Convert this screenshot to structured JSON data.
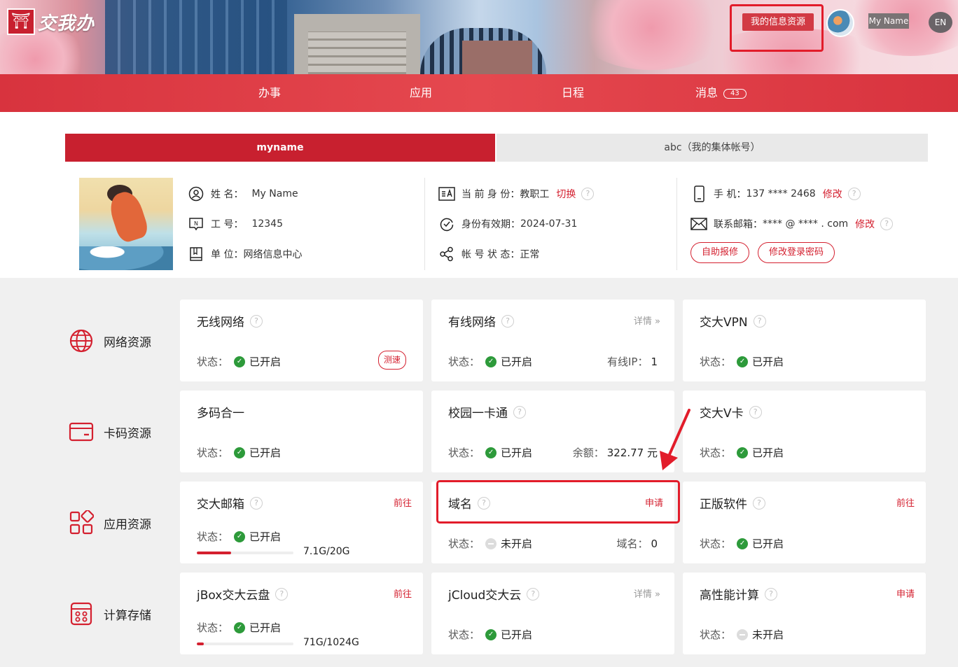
{
  "header": {
    "logo_text": "交我办",
    "info_link": "我的信息资源",
    "user_name": "My Name",
    "lang": "EN"
  },
  "nav": {
    "items": [
      {
        "label": "办事"
      },
      {
        "label": "应用"
      },
      {
        "label": "日程"
      },
      {
        "label": "消息"
      }
    ],
    "msg_count": "43"
  },
  "accounts": {
    "active": "myname",
    "inactive": "abc（我的集体帐号）"
  },
  "profile": {
    "name_label": "姓    名：",
    "name": "My Name",
    "id_label": "工    号：",
    "id": "12345",
    "unit_label": "单    位：",
    "unit": "网络信息中心",
    "identity_label": "当 前 身 份：",
    "identity": "教职工",
    "switch_label": "切换",
    "validity_label": "身份有效期：",
    "validity": "2024-07-31",
    "account_status_label": "帐 号 状 态：",
    "account_status": "正常",
    "phone_label": "手          机：",
    "phone": "137 **** 2468",
    "email_label": "联系邮箱：",
    "email": "**** @ **** . com",
    "modify_label": "修改",
    "repair_button": "自助报修",
    "password_button": "修改登录密码"
  },
  "categories": [
    {
      "label": "网络资源",
      "icon": "globe-icon"
    },
    {
      "label": "卡码资源",
      "icon": "card-icon"
    },
    {
      "label": "应用资源",
      "icon": "apps-icon"
    },
    {
      "label": "计算存储",
      "icon": "server-icon"
    }
  ],
  "status_label": "状态：",
  "cards": {
    "wifi": {
      "title": "无线网络",
      "status": "已开启",
      "speed": "测速"
    },
    "wired": {
      "title": "有线网络",
      "detail": "详情 »",
      "status": "已开启",
      "right_label": "有线IP：",
      "right_value": "1"
    },
    "vpn": {
      "title": "交大VPN",
      "status": "已开启"
    },
    "multicode": {
      "title": "多码合一",
      "status": "已开启"
    },
    "campus_card": {
      "title": "校园一卡通",
      "status": "已开启",
      "right_label": "余额：",
      "right_value": "322.77 元"
    },
    "vcard": {
      "title": "交大V卡",
      "status": "已开启"
    },
    "mail": {
      "title": "交大邮箱",
      "action": "前往",
      "status": "已开启",
      "storage": "7.1G/20G",
      "usage": 0.355
    },
    "domain": {
      "title": "域名",
      "action": "申请",
      "status": "未开启",
      "right_label": "域名：",
      "right_value": "0"
    },
    "software": {
      "title": "正版软件",
      "action": "前往",
      "status": "已开启"
    },
    "jbox": {
      "title": "jBox交大云盘",
      "action": "前往",
      "status": "已开启",
      "storage": "71G/1024G",
      "usage": 0.069
    },
    "jcloud": {
      "title": "jCloud交大云",
      "detail": "详情 »",
      "status": "已开启"
    },
    "hpc": {
      "title": "高性能计算",
      "action": "申请",
      "status": "未开启"
    }
  },
  "colors": {
    "brand_red": "#c8202f",
    "status_green": "#2d9a3a"
  }
}
